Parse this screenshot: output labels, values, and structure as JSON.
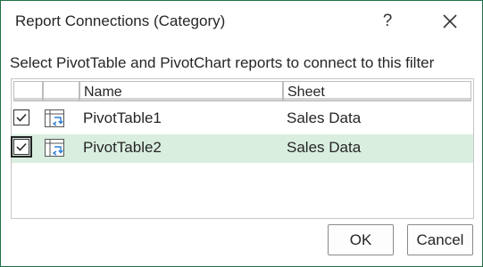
{
  "dialog": {
    "title": "Report Connections (Category)",
    "help_label": "?",
    "instruction": "Select PivotTable and PivotChart reports to connect to this filter"
  },
  "table": {
    "columns": [
      "Name",
      "Sheet"
    ],
    "rows": [
      {
        "name": "PivotTable1",
        "sheet": "Sales Data",
        "checked": true,
        "selected": false
      },
      {
        "name": "PivotTable2",
        "sheet": "Sales Data",
        "checked": true,
        "selected": true
      }
    ]
  },
  "buttons": {
    "ok": "OK",
    "cancel": "Cancel"
  },
  "colors": {
    "accent_border": "#1e7145",
    "selected_row": "#d9eedf",
    "icon_blue": "#2b7cd3"
  },
  "icons": {
    "close": "close-icon",
    "checkbox": "checkmark-icon",
    "pivot": "pivot-table-icon"
  }
}
